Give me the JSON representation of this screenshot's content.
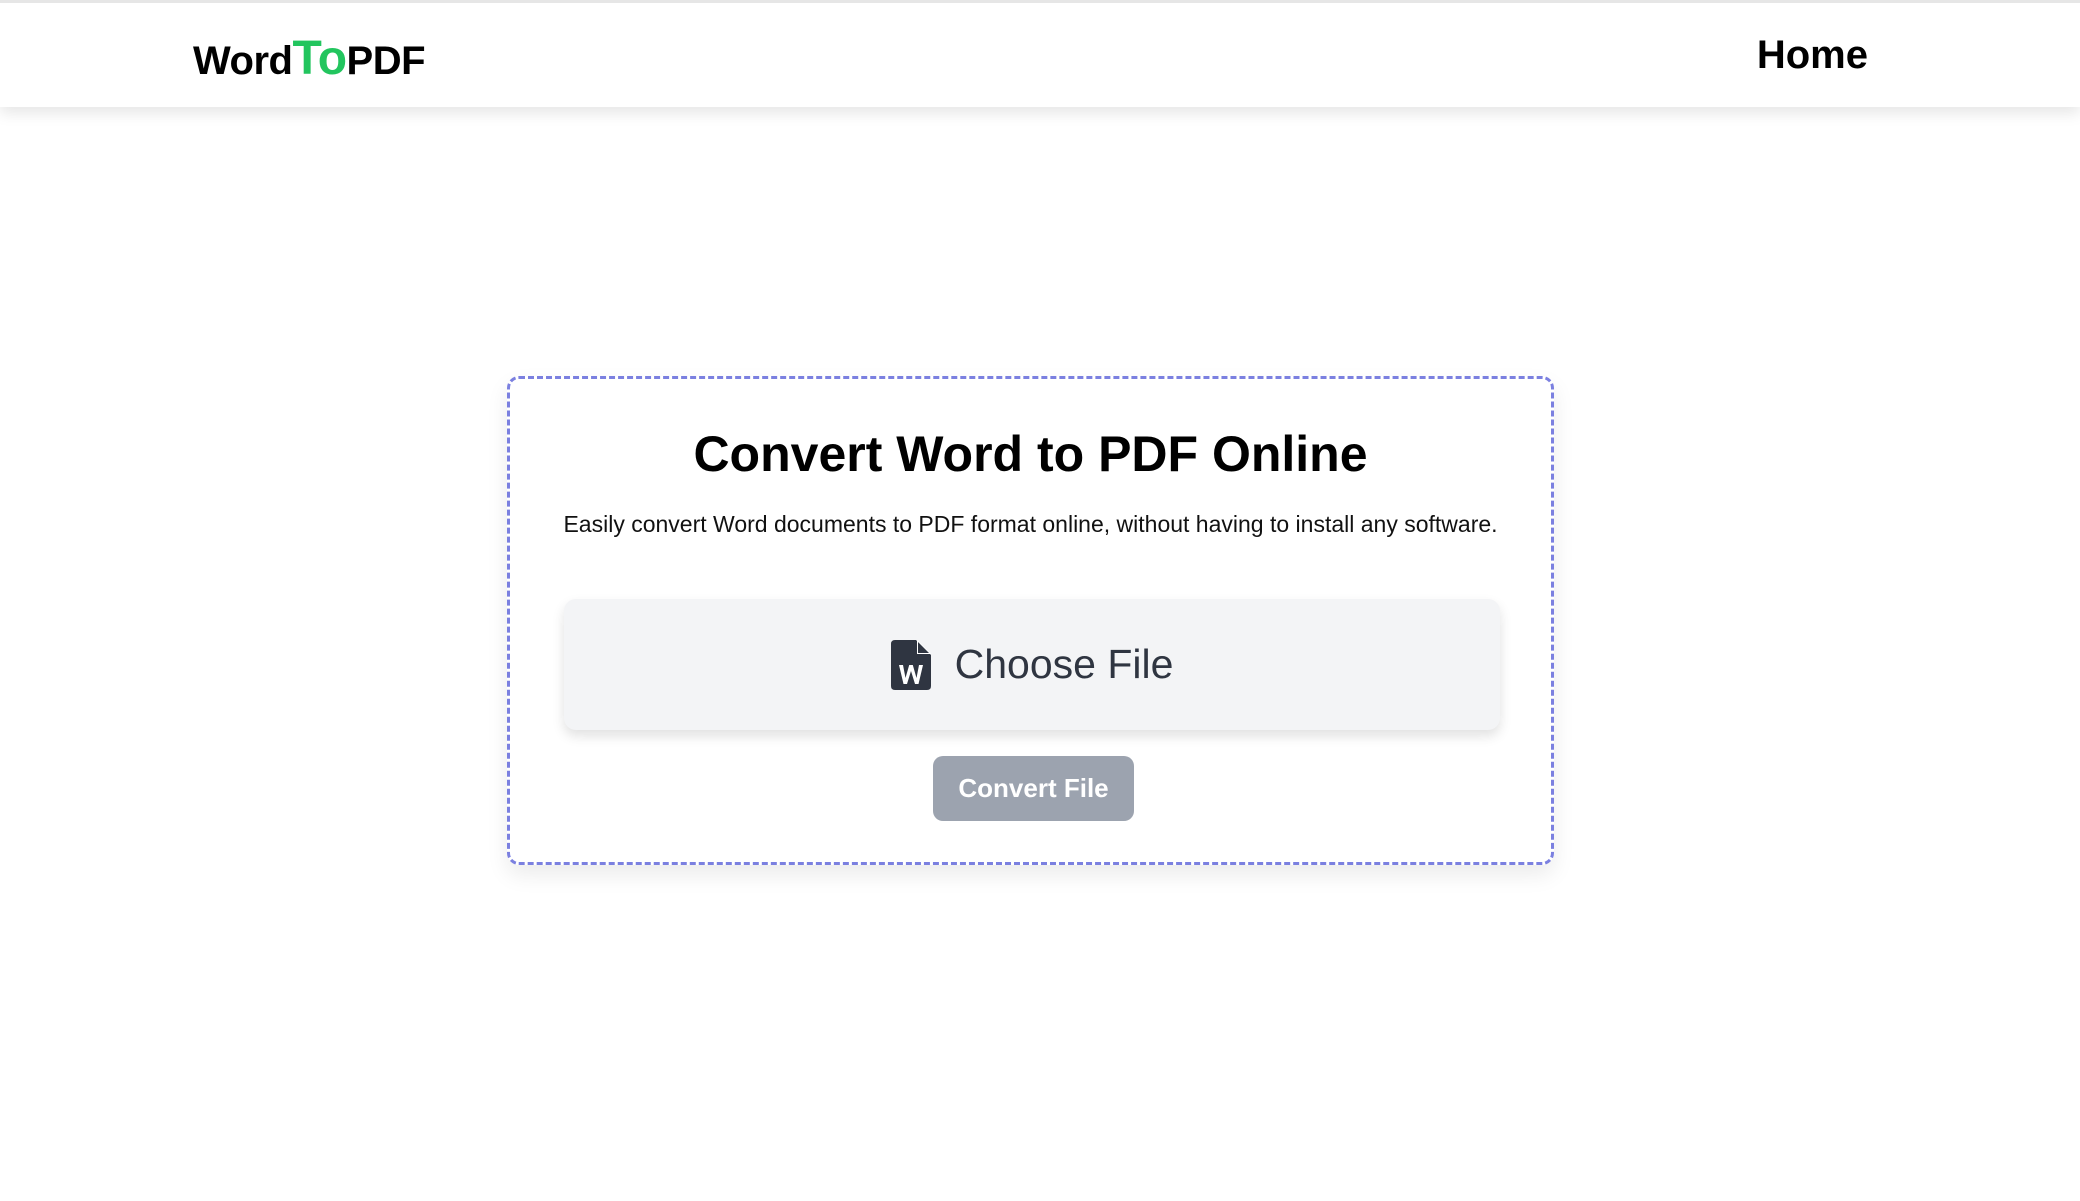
{
  "header": {
    "logo": {
      "part1": "Word",
      "part2": "To",
      "part3": "PDF"
    },
    "nav": {
      "home_label": "Home"
    }
  },
  "main": {
    "title": "Convert Word to PDF Online",
    "subtitle": "Easily convert Word documents to PDF format online, without having to install any software.",
    "file_picker": {
      "icon": "word-file-icon",
      "label": "Choose File"
    },
    "convert_button": {
      "label": "Convert File",
      "state": "disabled"
    }
  },
  "colors": {
    "logo_accent": "#22c55e",
    "card_border": "#7b80e0",
    "picker_background": "#f3f4f6",
    "button_disabled": "#9ca3af",
    "icon_color": "#2f3541"
  }
}
